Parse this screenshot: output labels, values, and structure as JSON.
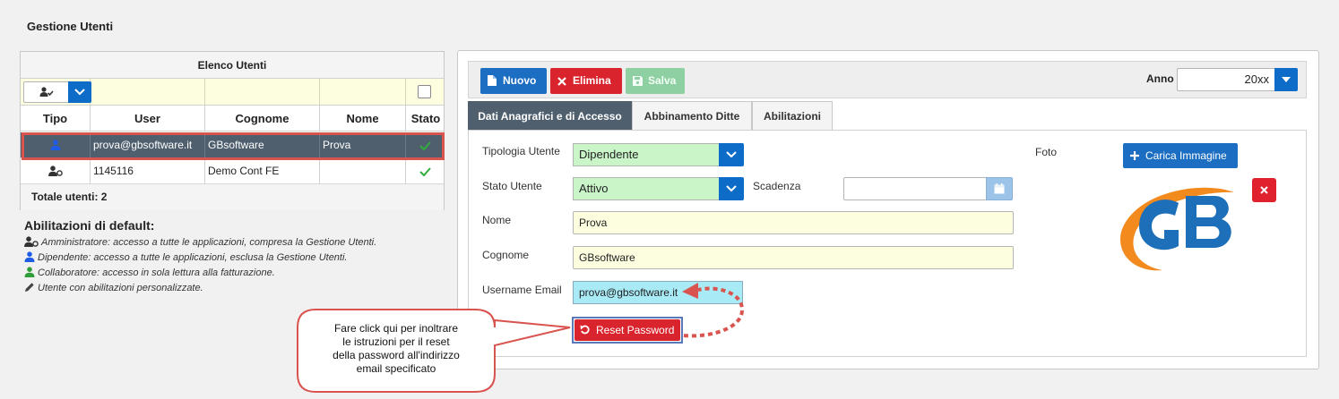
{
  "page_title": "Gestione Utenti",
  "users_list": {
    "title": "Elenco Utenti",
    "columns": [
      "Tipo",
      "User",
      "Cognome",
      "Nome",
      "Stato"
    ],
    "rows": [
      {
        "user": "prova@gbsoftware.it",
        "cognome": "GBsoftware",
        "nome": "Prova",
        "tipo_icon": "user-icon",
        "stato_icon": "check-icon"
      },
      {
        "user": "1145116",
        "cognome": "Demo Cont FE",
        "nome": "",
        "tipo_icon": "admin-user-icon",
        "stato_icon": "check-icon"
      }
    ],
    "total_label": "Totale utenti: 2"
  },
  "legend": {
    "title": "Abilitazioni di default:",
    "items": [
      "Amministratore: accesso a tutte le applicazioni, compresa la Gestione Utenti.",
      "Dipendente: accesso a tutte le applicazioni, esclusa la Gestione Utenti.",
      "Collaboratore: accesso in sola lettura alla fatturazione.",
      "Utente con abilitazioni personalizzate."
    ]
  },
  "toolbar": {
    "nuovo": "Nuovo",
    "elimina": "Elimina",
    "salva": "Salva",
    "anno_label": "Anno",
    "anno_value": "20xx"
  },
  "tabs": [
    "Dati Anagrafici e di Accesso",
    "Abbinamento Ditte",
    "Abilitazioni"
  ],
  "form": {
    "tipologia_label": "Tipologia Utente",
    "tipologia_value": "Dipendente",
    "stato_label": "Stato Utente",
    "stato_value": "Attivo",
    "scadenza_label": "Scadenza",
    "nome_label": "Nome",
    "nome_value": "Prova",
    "cognome_label": "Cognome",
    "cognome_value": "GBsoftware",
    "username_label": "Username Email",
    "username_value": "prova@gbsoftware.it",
    "reset_label": "Reset Password",
    "foto_label": "Foto",
    "carica_label": "Carica Immagine"
  },
  "callout": {
    "lines": [
      "Fare click qui per inoltrare",
      "le istruzioni per il reset",
      "della password all'indirizzo",
      "email specificato"
    ]
  },
  "colors": {
    "accent_blue": "#1b6ec2",
    "danger_red": "#d9232d",
    "selected_row": "#4f5f6e",
    "annotation_red": "#d9534f",
    "logo_blue": "#1c6fb8",
    "logo_orange": "#f28a1e"
  }
}
